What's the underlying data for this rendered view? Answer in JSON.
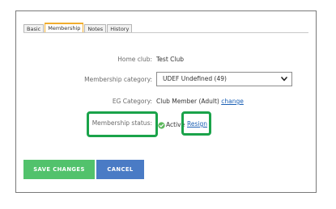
{
  "tabs": [
    {
      "label": "Basic",
      "active": false
    },
    {
      "label": "Membership",
      "active": true
    },
    {
      "label": "Notes",
      "active": false
    },
    {
      "label": "History",
      "active": false
    }
  ],
  "form": {
    "home_club": {
      "label": "Home club:",
      "value": "Test Club"
    },
    "membership_category": {
      "label": "Membership category:",
      "selected": "UDEF Undefined (49)"
    },
    "eg_category": {
      "label": "EG Category:",
      "value": "Club Member (Adult)",
      "link": "change"
    },
    "membership_status": {
      "label": "Membership status:",
      "value": "Active",
      "link": "Resign"
    }
  },
  "buttons": {
    "save": "SAVE CHANGES",
    "cancel": "CANCEL"
  },
  "colors": {
    "highlight": "#1aa34a",
    "save": "#52c26c",
    "cancel": "#4a7bc5",
    "active_tab": "#f0ad2e",
    "link": "#1a5fb4"
  },
  "icons": {
    "status": "check-circle-icon",
    "dropdown": "chevron-down-icon"
  }
}
